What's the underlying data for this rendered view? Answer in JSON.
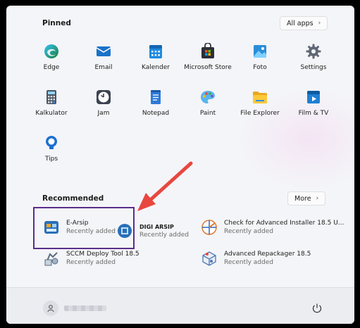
{
  "pinned": {
    "title": "Pinned",
    "all_apps_label": "All apps",
    "apps": [
      {
        "label": "Edge",
        "icon": "edge-icon"
      },
      {
        "label": "Email",
        "icon": "mail-icon"
      },
      {
        "label": "Kalender",
        "icon": "calendar-icon"
      },
      {
        "label": "Microsoft Store",
        "icon": "store-icon"
      },
      {
        "label": "Foto",
        "icon": "photos-icon"
      },
      {
        "label": "Settings",
        "icon": "gear-icon"
      },
      {
        "label": "Kalkulator",
        "icon": "calculator-icon"
      },
      {
        "label": "Jam",
        "icon": "clock-icon"
      },
      {
        "label": "Notepad",
        "icon": "notepad-icon"
      },
      {
        "label": "Paint",
        "icon": "paint-icon"
      },
      {
        "label": "File Explorer",
        "icon": "folder-icon"
      },
      {
        "label": "Film & TV",
        "icon": "film-icon"
      },
      {
        "label": "Tips",
        "icon": "tips-icon"
      }
    ]
  },
  "recommended": {
    "title": "Recommended",
    "more_label": "More",
    "items": [
      {
        "name": "E-Arsip",
        "sub": "Recently added",
        "icon": "e-arsip-icon"
      },
      {
        "name": "DIGI ARSIP",
        "sub": "Recently added",
        "icon": "digi-arsip-icon"
      },
      {
        "name": "Check for Advanced Installer 18.5 U...",
        "sub": "Recently added",
        "icon": "advanced-installer-icon"
      },
      {
        "name": "SCCM Deploy Tool 18.5",
        "sub": "Recently added",
        "icon": "sccm-deploy-icon"
      },
      {
        "name": "Advanced Repackager 18.5",
        "sub": "Recently added",
        "icon": "repackager-icon"
      }
    ]
  },
  "colors": {
    "annotation_arrow": "#e8473f",
    "highlight_box": "#5a2d8c"
  }
}
